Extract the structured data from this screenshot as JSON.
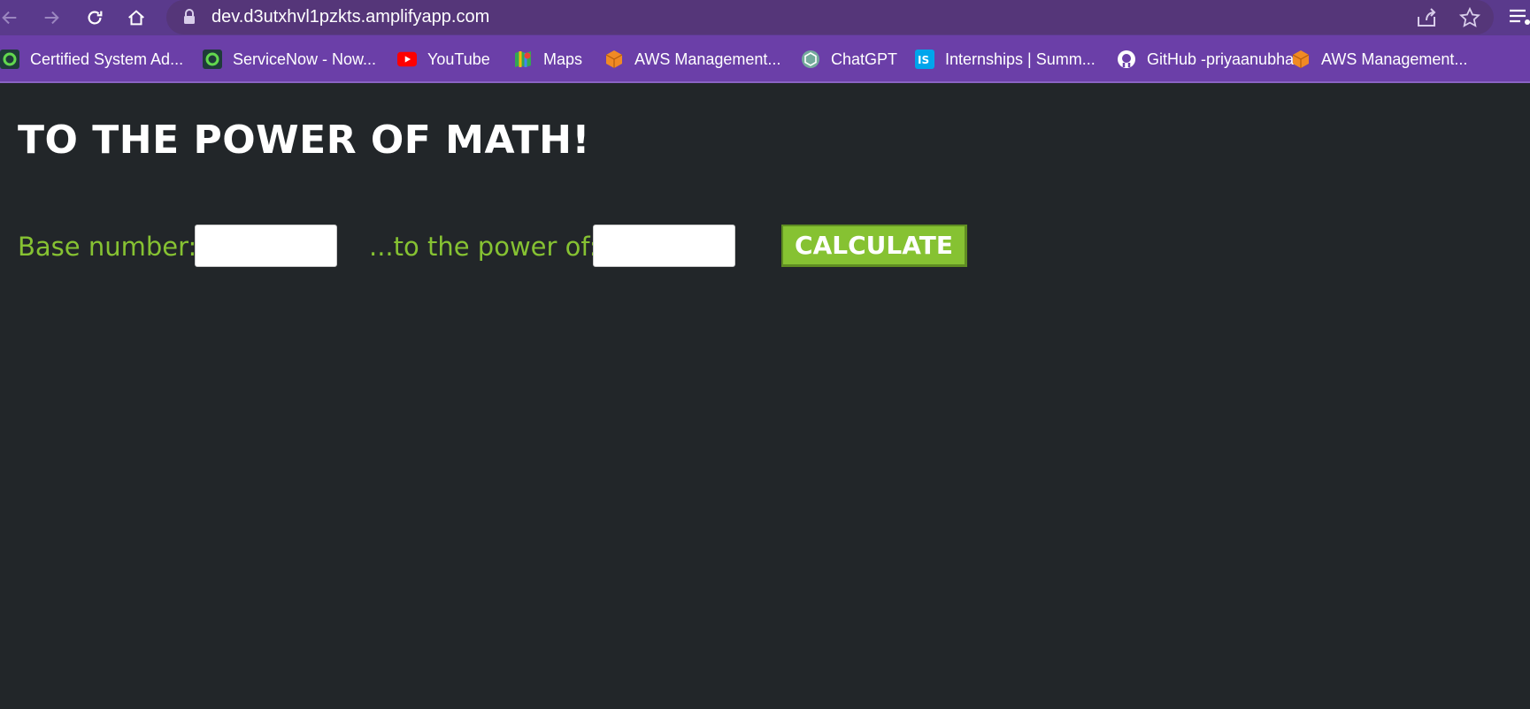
{
  "browser": {
    "url": "dev.d3utxhvl1pzkts.amplifyapp.com",
    "bookmarks": [
      {
        "label": "Certified System Ad...",
        "icon": "servicenow-icon"
      },
      {
        "label": "ServiceNow - Now...",
        "icon": "servicenow-icon"
      },
      {
        "label": "YouTube",
        "icon": "youtube-icon"
      },
      {
        "label": "Maps",
        "icon": "maps-icon"
      },
      {
        "label": "AWS Management...",
        "icon": "aws-icon"
      },
      {
        "label": "ChatGPT",
        "icon": "chatgpt-icon"
      },
      {
        "label": "Internships | Summ...",
        "icon": "internshala-icon"
      },
      {
        "label": "GitHub -priyaanubha",
        "icon": "github-icon"
      },
      {
        "label": "AWS Management...",
        "icon": "aws-icon"
      }
    ],
    "chrome_color": "#5a3a8c"
  },
  "page": {
    "title": "TO THE POWER OF MATH!",
    "base_label": "Base number:",
    "base_value": "",
    "power_label": "...to the power of:",
    "power_value": "",
    "button_label": "CALCULATE",
    "accent_color": "#86c232",
    "background_color": "#222629"
  }
}
